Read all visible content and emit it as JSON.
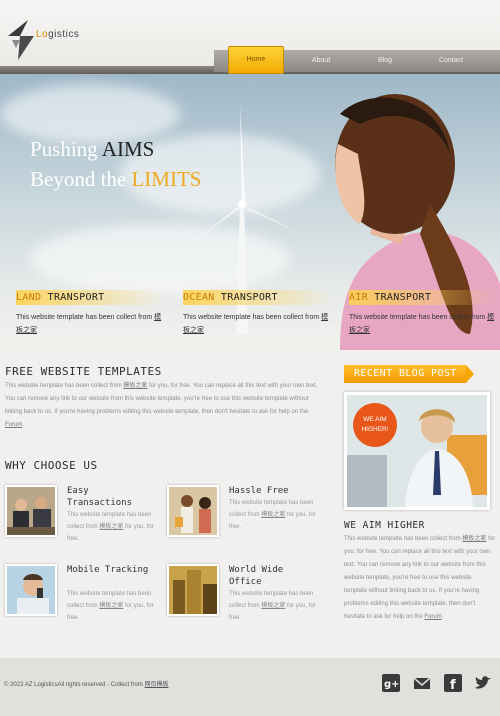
{
  "logo": {
    "prefix": "",
    "text_accent": "Lo",
    "text_rest": "gistics"
  },
  "nav": [
    {
      "label": "Home",
      "active": true
    },
    {
      "label": "About",
      "active": false
    },
    {
      "label": "Blog",
      "active": false
    },
    {
      "label": "Contact",
      "active": false
    }
  ],
  "banner": {
    "line1_light": "Pushing ",
    "line1_dark": "AIMS",
    "line2_light": "Beyond the ",
    "line2_gold": "LIMITS"
  },
  "features": [
    {
      "gold": "LAND",
      "rest": " TRANSPORT",
      "text": "This website template has been collect from ",
      "link": "模板之家"
    },
    {
      "gold": "OCEAN",
      "rest": " TRANSPORT",
      "text": "This website template has been collect from ",
      "link": "模板之家"
    },
    {
      "gold": "AIR",
      "rest": " TRANSPORT",
      "text": "This website template has been collect from ",
      "link": "模板之家"
    }
  ],
  "free": {
    "title": "FREE WEBSITE TEMPLATES",
    "text_a": "This website template has been collect from ",
    "link_a": "模板之家",
    "text_b": " for you, for free. You can replace all this text with your own text. You can remove any link to our website from this website template, you're free to use this website template without linking back to us. If you're having problems editing this website template, then don't hesitate to ask for help on the ",
    "link_b": "Forum",
    "text_c": "."
  },
  "why": {
    "title": "WHY CHOOSE US",
    "items": [
      {
        "name": "Easy Transactions",
        "text": "This website template has been collect from ",
        "link": "模板之家",
        "tail": " for you, for free."
      },
      {
        "name": "Hassle Free",
        "text": "This website template has been collect from ",
        "link": "模板之家",
        "tail": " for you, for free."
      },
      {
        "name": "Mobile Tracking",
        "text": "This website template has been collect from ",
        "link": "模板之家",
        "tail": " for you, for free."
      },
      {
        "name": "World Wide Office",
        "text": "This website template has been collect from ",
        "link": "模板之家",
        "tail": " for you, for free."
      }
    ]
  },
  "blog": {
    "tag": "RECENT BLOG POST",
    "badge_line1": "WE AIM",
    "badge_line2": "HIGHER!",
    "title": "WE AIM HIGHER",
    "text_a": "This website template has been collect from ",
    "link_a": "模板之家",
    "text_b": " for you, for free. You can replace all this text with your own text. You can remove any link to our website from this website template, you're free to use this website template without linking back to us. If you're having problems editing this website template, then don't hesitate to ask for help on the ",
    "link_b": "Forum",
    "text_c": "."
  },
  "footer": {
    "copy": "© 2023 AZ LogisticsAll rights reserved - Collect from ",
    "link": "网页模板",
    "social": [
      "google-plus-icon",
      "mail-icon",
      "facebook-icon",
      "twitter-icon"
    ]
  },
  "colors": {
    "accent": "#f2a900",
    "badge": "#e8561a",
    "footer": "#e1e0dd"
  }
}
